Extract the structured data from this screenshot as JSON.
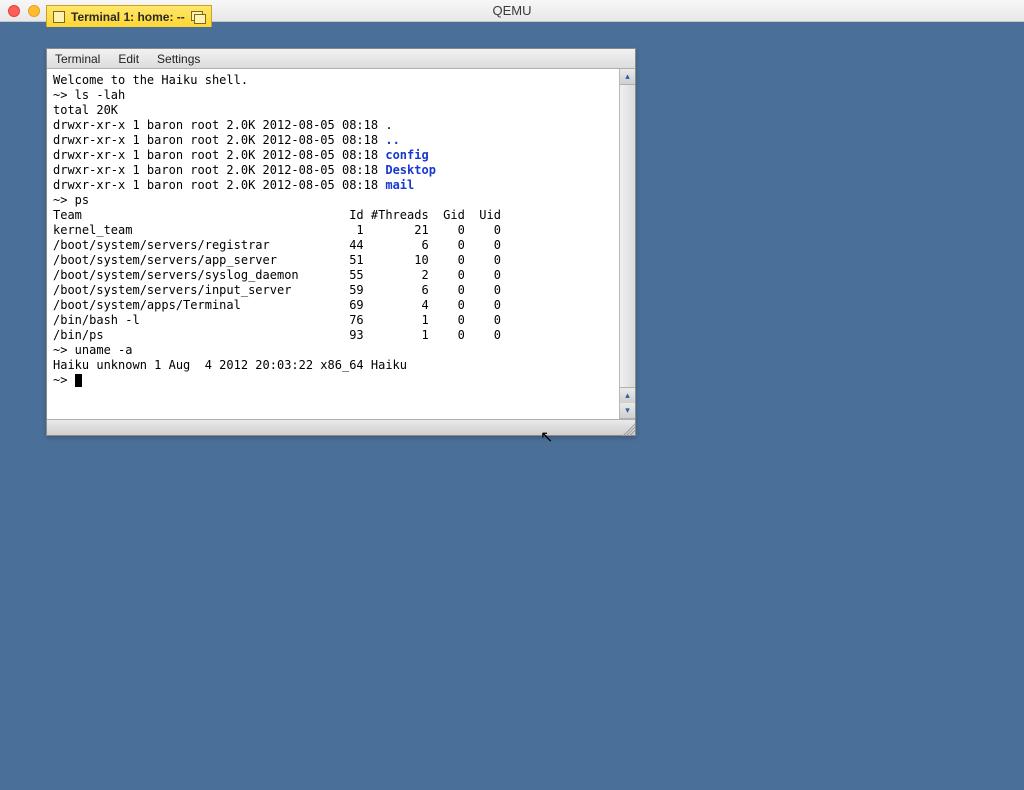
{
  "host": {
    "title": "QEMU"
  },
  "window": {
    "tabTitle": "Terminal 1: home: --"
  },
  "menu": {
    "terminal": "Terminal",
    "edit": "Edit",
    "settings": "Settings"
  },
  "terminal": {
    "welcome": "Welcome to the Haiku shell.",
    "prompt": "~>",
    "cmd_ls": "ls -lah",
    "ls_total": "total 20K",
    "ls_rows": [
      {
        "perm": "drwxr-xr-x 1 baron root 2.0K 2012-08-05 08:18 ",
        "name": ".",
        "link": false
      },
      {
        "perm": "drwxr-xr-x 1 baron root 2.0K 2012-08-05 08:18 ",
        "name": "..",
        "link": true
      },
      {
        "perm": "drwxr-xr-x 1 baron root 2.0K 2012-08-05 08:18 ",
        "name": "config",
        "link": true
      },
      {
        "perm": "drwxr-xr-x 1 baron root 2.0K 2012-08-05 08:18 ",
        "name": "Desktop",
        "link": true
      },
      {
        "perm": "drwxr-xr-x 1 baron root 2.0K 2012-08-05 08:18 ",
        "name": "mail",
        "link": true
      }
    ],
    "cmd_ps": "ps",
    "ps_header": "Team                                     Id #Threads  Gid  Uid",
    "ps_rows": [
      "kernel_team                               1       21    0    0",
      "/boot/system/servers/registrar           44        6    0    0",
      "/boot/system/servers/app_server          51       10    0    0",
      "/boot/system/servers/syslog_daemon       55        2    0    0",
      "/boot/system/servers/input_server        59        6    0    0",
      "/boot/system/apps/Terminal               69        4    0    0",
      "/bin/bash -l                             76        1    0    0",
      "/bin/ps                                  93        1    0    0"
    ],
    "cmd_uname": "uname -a",
    "uname_out": "Haiku unknown 1 Aug  4 2012 20:03:22 x86_64 Haiku"
  }
}
